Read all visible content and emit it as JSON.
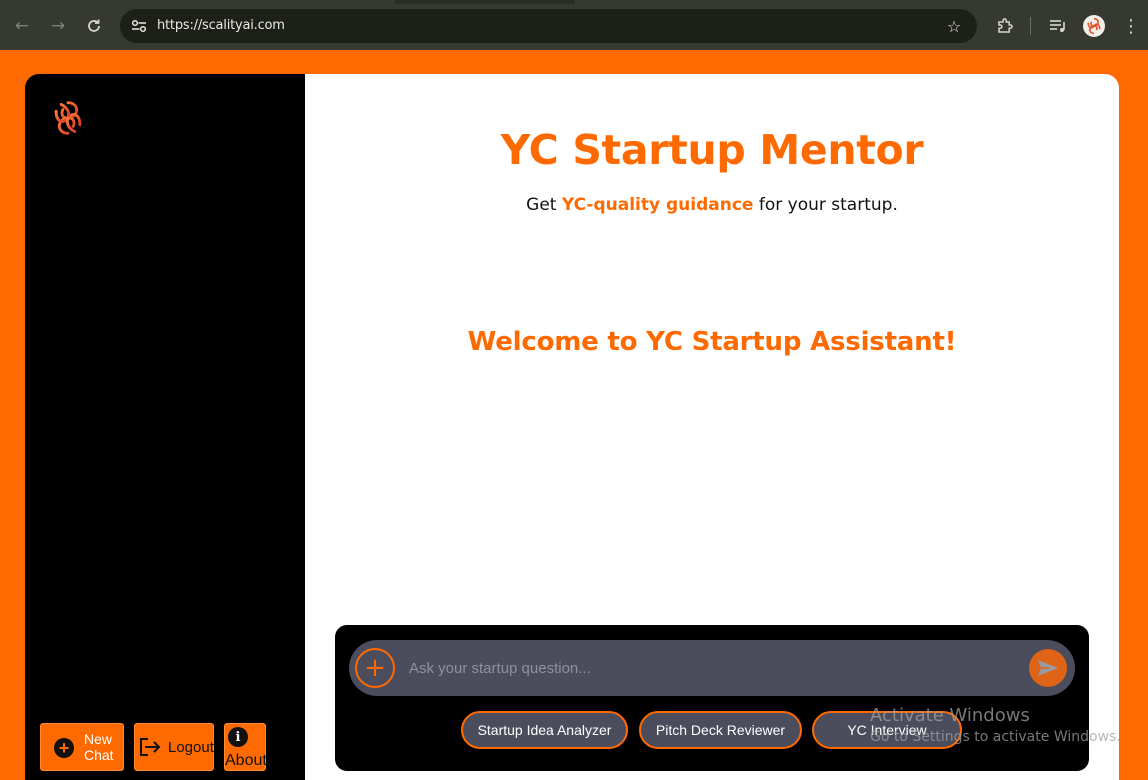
{
  "browser": {
    "url": "https://scalityai.com",
    "back_icon": "arrow-left-icon",
    "forward_icon": "arrow-right-icon",
    "reload_icon": "reload-icon"
  },
  "sidebar": {
    "new_chat_label": "New Chat",
    "logout_label": "Logout",
    "about_label": "About"
  },
  "main": {
    "title": "YC Startup Mentor",
    "subtitle_prefix": "Get",
    "subtitle_highlight": "YC-quality guidance",
    "subtitle_suffix": "for your startup.",
    "welcome": "Welcome to YC Startup Assistant!"
  },
  "chat": {
    "placeholder": "Ask your startup question...",
    "chips": [
      "Startup Idea Analyzer",
      "Pitch Deck Reviewer",
      "YC Interview"
    ]
  },
  "watermark": {
    "line1": "Activate Windows",
    "line2": "Go to Settings to activate Windows."
  },
  "colors": {
    "brand": "#ff6a00",
    "sidebar_bg": "#000000",
    "input_bg": "#4b4d5d"
  }
}
